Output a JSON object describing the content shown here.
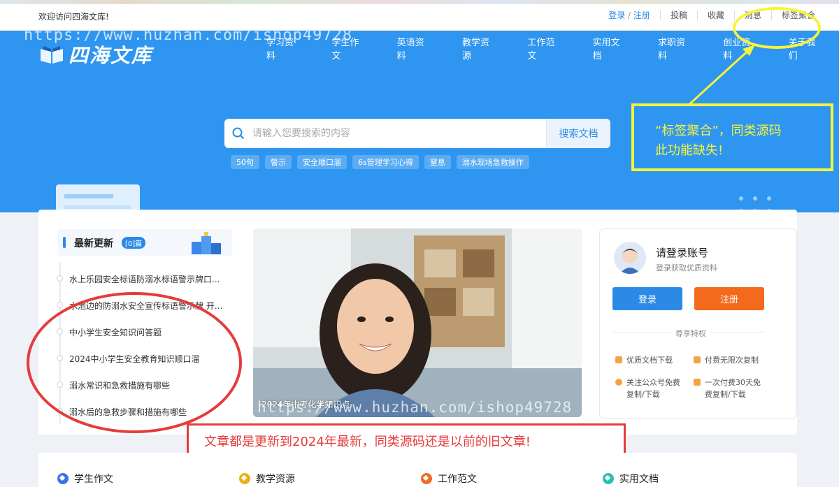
{
  "topbar": {
    "welcome": "欢迎访问四海文库!",
    "login": "登录",
    "slash": "/",
    "register": "注册",
    "links": [
      "投稿",
      "收藏",
      "消息",
      "标签聚合"
    ]
  },
  "brand": {
    "name": "四海文库"
  },
  "nav": [
    "学习资料",
    "学生作文",
    "英语资料",
    "教学资源",
    "工作范文",
    "实用文档",
    "求职资料",
    "创业资料",
    "关于我们"
  ],
  "search": {
    "placeholder": "请输入您要搜索的内容",
    "button": "搜索文档"
  },
  "hot_tags": [
    "50句",
    "警示",
    "安全顺口溜",
    "6s管理学习心得",
    "窒息",
    "溺水现场急救操作"
  ],
  "latest": {
    "title": "最新更新",
    "badge": "[0]篇",
    "articles": [
      "水上乐园安全标语防溺水标语警示牌口...",
      "水池边的防溺水安全宣传标语警示牌 开...",
      "中小学生安全知识问答题",
      "2024中小学生安全教育知识顺口溜",
      "溺水常识和急救措施有哪些",
      "溺水后的急救步骤和措施有哪些"
    ]
  },
  "featured": {
    "caption": "2024年中考化学知识点"
  },
  "login_panel": {
    "title": "请登录账号",
    "subtitle": "登录获取优质资料",
    "login_btn": "登录",
    "register_btn": "注册",
    "privileges_title": "尊享特权",
    "perks": [
      {
        "line1": "优质文档下载",
        "line2": ""
      },
      {
        "line1": "付费无限次复制",
        "line2": ""
      },
      {
        "line1": "关注公众号免费",
        "line2": "复制/下载"
      },
      {
        "line1": "一次付费30天免",
        "line2": "费复制/下载"
      }
    ]
  },
  "categories": [
    "学生作文",
    "教学资源",
    "工作范文",
    "实用文档"
  ],
  "annotations": {
    "yellow_note_line1": "“标签聚合”，同类源码",
    "yellow_note_line2": "此功能缺失!",
    "red_note": "文章都是更新到2024年最新，同类源码还是以前的旧文章!"
  },
  "watermarks": [
    "https://www.huzhan.com/ishop49728",
    "https://www.huzhan.com/ishop49728"
  ],
  "colors": {
    "hero_blue": "#2e95f0",
    "link_blue": "#2a8ae6",
    "register_orange": "#f46a1c",
    "annotation_yellow": "#f6f43a",
    "annotation_red": "#e53b3b"
  }
}
